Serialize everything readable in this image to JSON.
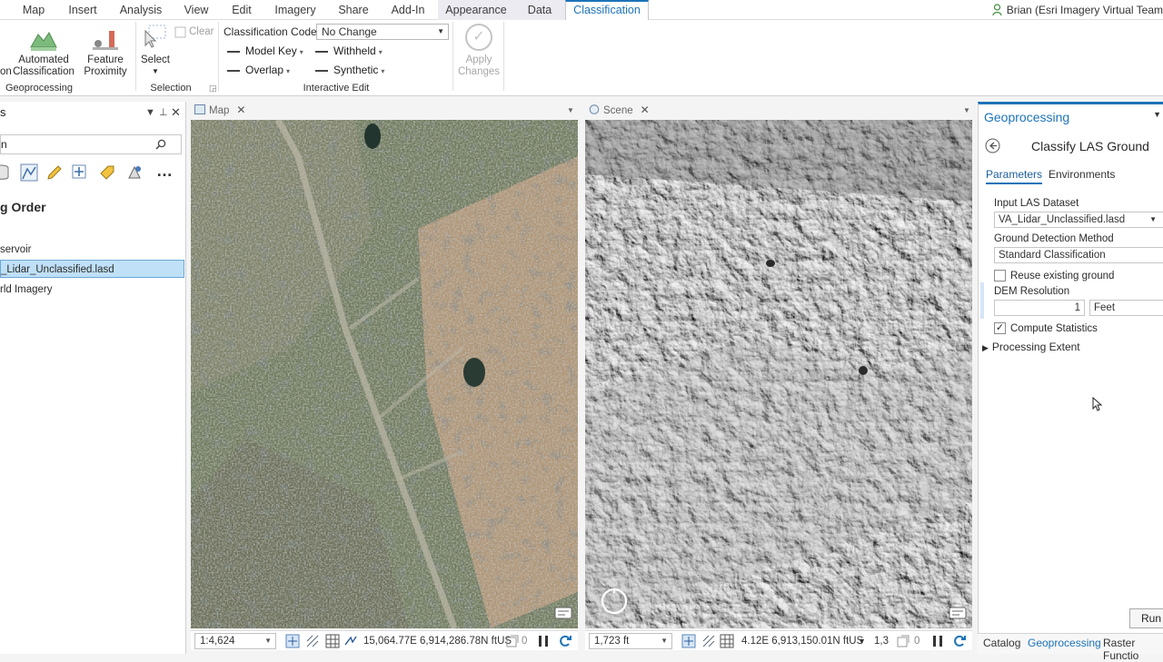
{
  "tabs": [
    "Map",
    "Insert",
    "Analysis",
    "View",
    "Edit",
    "Imagery",
    "Share",
    "Add-In",
    "Appearance",
    "Data",
    "Classification"
  ],
  "active_tab": "Classification",
  "user": "Brian (Esri Imagery Virtual Team",
  "ribbon": {
    "automated_classification": [
      "Automated",
      "Classification"
    ],
    "feature_proximity": [
      "Feature",
      "Proximity"
    ],
    "geoprocessing_group": "Geoprocessing",
    "select_label": "Select",
    "clear_label": "Clear",
    "selection_group": "Selection",
    "classification_code_label": "Classification Code",
    "classification_code_value": "No Change",
    "model_key": "Model Key",
    "withheld": "Withheld",
    "overlap": "Overlap",
    "synthetic": "Synthetic",
    "interactive_edit_group": "Interactive Edit",
    "apply_changes": [
      "Apply",
      "Changes"
    ],
    "partial_left_label": "on"
  },
  "contents": {
    "header": "s",
    "search_text": "n",
    "draw_order": "g Order",
    "layers": [
      "servoir",
      "_Lidar_Unclassified.lasd",
      "rld Imagery"
    ]
  },
  "views": {
    "map_tab": "Map",
    "scene_tab": "Scene"
  },
  "map_status": {
    "scale": "1:4,624",
    "coords": "15,064.77E 6,914,286.78N ftUS",
    "count": "0"
  },
  "scene_status": {
    "distance": "1,723 ft",
    "coords": "4.12E 6,913,150.01N ftUS",
    "partial": "1,3",
    "count": "0"
  },
  "geoprocessing": {
    "title": "Geoprocessing",
    "tool": "Classify LAS Ground",
    "tabs": [
      "Parameters",
      "Environments"
    ],
    "input_label": "Input LAS Dataset",
    "input_value": "VA_Lidar_Unclassified.lasd",
    "method_label": "Ground Detection Method",
    "method_value": "Standard Classification",
    "reuse_ground": "Reuse existing ground",
    "reuse_checked": false,
    "dem_label": "DEM Resolution",
    "dem_value": "1",
    "dem_unit": "Feet",
    "compute_stats": "Compute Statistics",
    "compute_checked": true,
    "processing_extent": "Processing Extent",
    "run": "Run"
  },
  "bottom_tabs": [
    "Catalog",
    "Geoprocessing",
    "Raster Functio"
  ],
  "colors": {
    "accent": "#1d73b8",
    "selected_layer": "#bfe0f7"
  }
}
